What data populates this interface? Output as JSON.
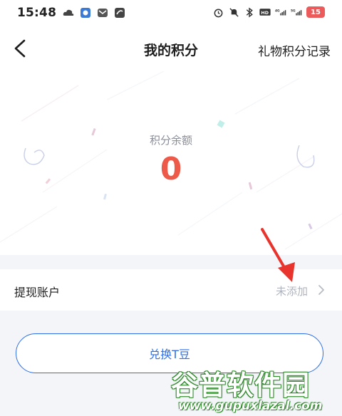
{
  "status_bar": {
    "time": "15:48",
    "left_icons": [
      "cloud-icon",
      "app-icon",
      "mail-icon",
      "sync-icon"
    ],
    "right_icons": [
      "alarm-icon",
      "mute-icon",
      "bluetooth-icon",
      "hd-icon",
      "signal-4g-icon",
      "signal-5g-icon"
    ],
    "battery_level": "15",
    "battery_color": "#ec5b5b"
  },
  "nav": {
    "back_icon": "chevron-left-icon",
    "title": "我的积分",
    "right_link": "礼物积分记录"
  },
  "points": {
    "label": "积分余额",
    "value": "0",
    "value_color": "#ee5a4a"
  },
  "account": {
    "label": "提现账户",
    "status": "未添加",
    "chevron_icon": "chevron-right-icon"
  },
  "exchange": {
    "label": "兑换T豆",
    "accent_color": "#2f6fe6"
  },
  "watermark": {
    "cn": "谷普软件园",
    "url": "www.gupuxlazal.com"
  }
}
